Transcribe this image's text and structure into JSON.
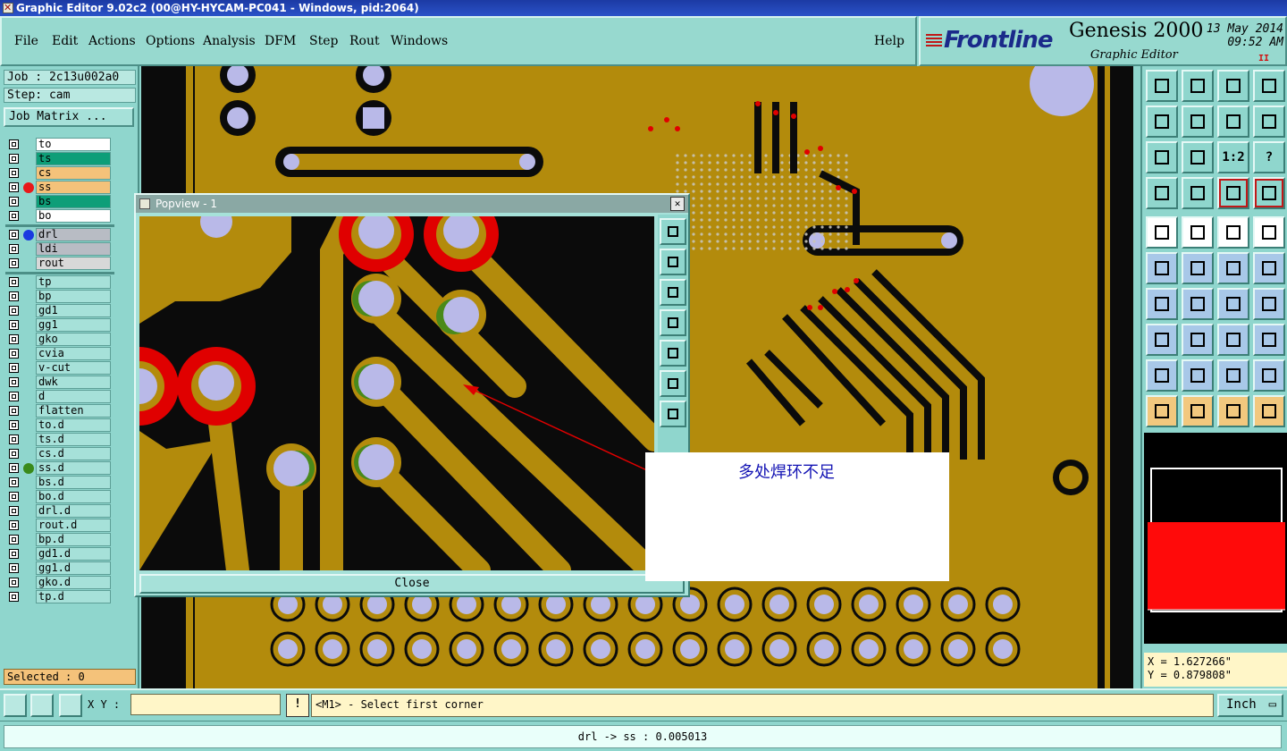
{
  "window": {
    "title": "Graphic Editor 9.02c2 (00@HY-HYCAM-PC041 - Windows, pid:2064)"
  },
  "menu": {
    "items": [
      {
        "label": "File"
      },
      {
        "label": "Edit"
      },
      {
        "label": "Actions"
      },
      {
        "label": "Options"
      },
      {
        "label": "Analysis"
      },
      {
        "label": "DFM"
      },
      {
        "label": "Step"
      },
      {
        "label": "Rout"
      },
      {
        "label": "Windows"
      }
    ],
    "help": "Help"
  },
  "brand": {
    "company": "Frontline",
    "product": "Genesis 2000",
    "subtitle": "Graphic Editor",
    "date": "13 May 2014",
    "time": "09:52 AM",
    "marks": "II"
  },
  "job": {
    "job_label": "Job : 2c13u002a0",
    "step_label": "Step: cam",
    "matrix_button": "Job Matrix ..."
  },
  "layers": {
    "group1": [
      {
        "name": "to",
        "bg": "#ffffff",
        "dot": ""
      },
      {
        "name": "ts",
        "bg": "#0e9e78",
        "dot": ""
      },
      {
        "name": "cs",
        "bg": "#f4c27a",
        "dot": ""
      },
      {
        "name": "ss",
        "bg": "#f4c27a",
        "dot": "#e8181a"
      },
      {
        "name": "bs",
        "bg": "#0e9e78",
        "dot": ""
      },
      {
        "name": "bo",
        "bg": "#ffffff",
        "dot": ""
      }
    ],
    "group2": [
      {
        "name": "drl",
        "bg": "#b8bcc4",
        "dot": "#1a3ae0"
      },
      {
        "name": "ldi",
        "bg": "#b8bcc4",
        "dot": ""
      },
      {
        "name": "rout",
        "bg": "#d8d8d8",
        "dot": ""
      }
    ],
    "group3": [
      {
        "name": "tp",
        "dot": ""
      },
      {
        "name": "bp",
        "dot": ""
      },
      {
        "name": "gd1",
        "dot": ""
      },
      {
        "name": "gg1",
        "dot": ""
      },
      {
        "name": "gko",
        "dot": ""
      },
      {
        "name": "cvia",
        "dot": ""
      },
      {
        "name": "v-cut",
        "dot": ""
      },
      {
        "name": "dwk",
        "dot": ""
      },
      {
        "name": "d",
        "dot": ""
      },
      {
        "name": "flatten",
        "dot": ""
      },
      {
        "name": "to.d",
        "dot": ""
      },
      {
        "name": "ts.d",
        "dot": ""
      },
      {
        "name": "cs.d",
        "dot": ""
      },
      {
        "name": "ss.d",
        "dot": "#3a8a1a"
      },
      {
        "name": "bs.d",
        "dot": ""
      },
      {
        "name": "bo.d",
        "dot": ""
      },
      {
        "name": "drl.d",
        "dot": ""
      },
      {
        "name": "rout.d",
        "dot": ""
      },
      {
        "name": "bp.d",
        "dot": ""
      },
      {
        "name": "gd1.d",
        "dot": ""
      },
      {
        "name": "gg1.d",
        "dot": ""
      },
      {
        "name": "gko.d",
        "dot": ""
      },
      {
        "name": "tp.d",
        "dot": ""
      }
    ]
  },
  "selected": "Selected : 0",
  "popview": {
    "title": "Popview - 1",
    "close_label": "Close"
  },
  "annotation": {
    "text": "多处焊环不足"
  },
  "toolbar": {
    "rows": [
      [
        "home-icon",
        "step-down-icon",
        "house-icon",
        "panel-icon"
      ],
      [
        "pan-left-icon",
        "pan-right-icon",
        "swap-icon",
        "s-curve-icon"
      ],
      [
        "fit-icon",
        "zoom-icon",
        "scale-12-icon",
        "help-icon"
      ],
      [
        "tools-icon",
        "grid-icon",
        "layers-icon",
        "layers-alt-icon"
      ],
      [
        "pad-icon",
        "shape-icon",
        "ruler-icon",
        "target-icon"
      ],
      [
        "net-icon",
        "cross-icon",
        "arrow-node-icon",
        "arrow-node-alt-icon"
      ],
      [
        "line-icon",
        "diag-icon",
        "arc-icon",
        "ff-icon"
      ],
      [
        "node-icon",
        "split-icon",
        "box-measure-icon",
        "cluster-icon"
      ],
      [
        "tri-icon",
        "tri-alt-icon",
        "a-icon",
        "a-alt-icon"
      ],
      [
        "pointer-icon",
        "pointer-box-icon",
        "pointer-select-icon",
        "route-icon"
      ]
    ],
    "scale_label": "1:2",
    "help_label": "?"
  },
  "coords": {
    "x": "X = 1.627266\"",
    "y": "Y = 0.879808\""
  },
  "command": {
    "xy_label": "X Y :",
    "xy_value": "",
    "bang": "!",
    "prompt": "<M1> - Select first corner",
    "units": "Inch"
  },
  "status": "drl -> ss : 0.005013",
  "colors": {
    "board": "#b8900a",
    "copper": "#b38b0c",
    "pad": "#b9b9e8",
    "drill_hit": "#e00000",
    "canvas_bg": "#0b0b0b"
  }
}
